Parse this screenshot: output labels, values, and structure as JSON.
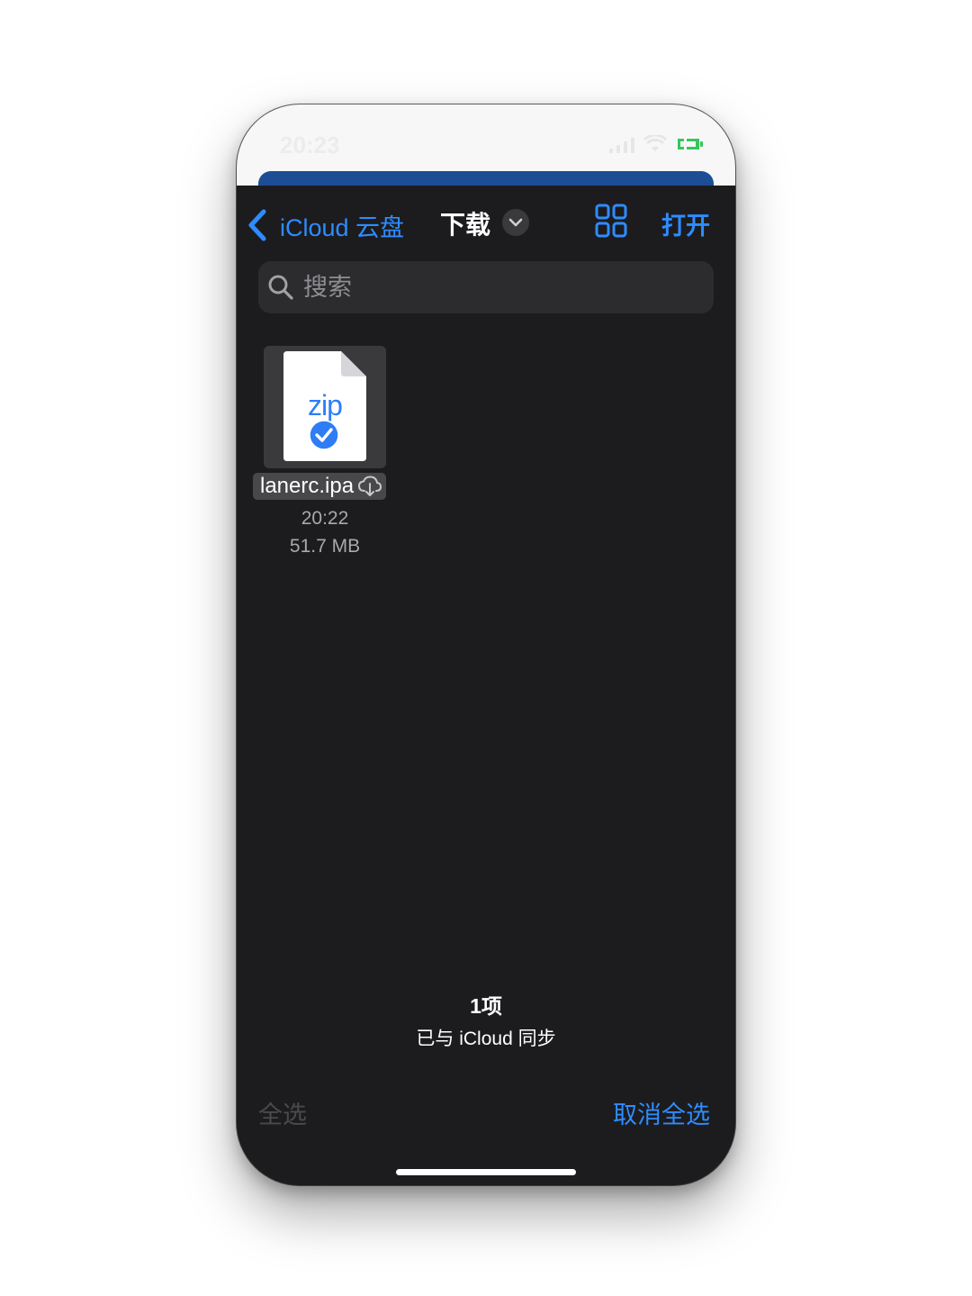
{
  "status_bar": {
    "time": "20:23",
    "icons": [
      "signal-icon",
      "wifi-icon",
      "battery-icon"
    ],
    "battery_color": "#34c759"
  },
  "nav": {
    "back_label": "iCloud 云盘",
    "title": "下载",
    "open_label": "打开",
    "icons": [
      "chevron-left-icon",
      "chevron-down-icon",
      "grid-view-icon"
    ]
  },
  "search": {
    "placeholder": "搜索",
    "value": ""
  },
  "files": [
    {
      "type_label": "zip",
      "name": "lanerc.ipa",
      "time": "20:22",
      "size": "51.7 MB",
      "selected": true,
      "icons": [
        "zip-file-icon",
        "check-badge-icon",
        "cloud-download-icon"
      ]
    }
  ],
  "footer": {
    "count": "1项",
    "sync_status": "已与 iCloud 同步"
  },
  "toolbar": {
    "select_all_label": "全选",
    "deselect_all_label": "取消全选"
  },
  "colors": {
    "accent": "#2f8cff",
    "background": "#1c1c1e",
    "search_background": "#2c2c2e",
    "disabled_text": "#4a4a4d"
  }
}
